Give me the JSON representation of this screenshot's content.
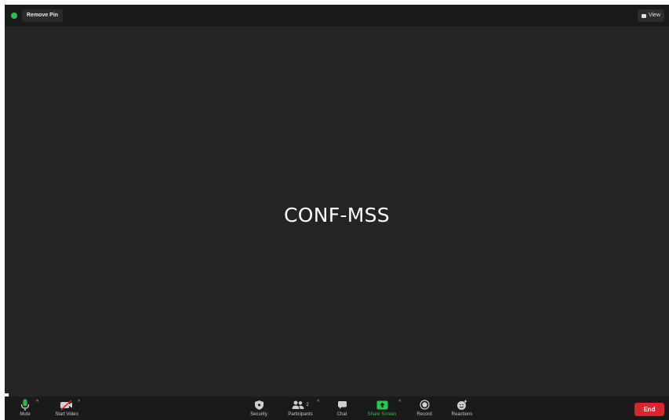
{
  "topbar": {
    "remove_pin_label": "Remove Pin",
    "view_label": "View"
  },
  "stage": {
    "participant_name": "CONF-MSS"
  },
  "toolbar": {
    "mute_label": "Mute",
    "start_video_label": "Start Video",
    "security_label": "Security",
    "participants_label": "Participants",
    "participants_count": "2",
    "chat_label": "Chat",
    "share_screen_label": "Share Screen",
    "record_label": "Record",
    "reactions_label": "Reactions",
    "end_label": "End"
  },
  "colors": {
    "background": "#242424",
    "bar": "#1a1a1a",
    "share_green": "#29c94a",
    "end_red": "#d8262c",
    "security_dot": "#2fbf49"
  },
  "icons": [
    "shield-dot-icon",
    "grid-view-icon",
    "mic-icon",
    "video-off-icon",
    "shield-icon",
    "people-icon",
    "chat-bubble-icon",
    "share-up-arrow-icon",
    "record-icon",
    "reactions-icon",
    "caret-up-icon"
  ]
}
